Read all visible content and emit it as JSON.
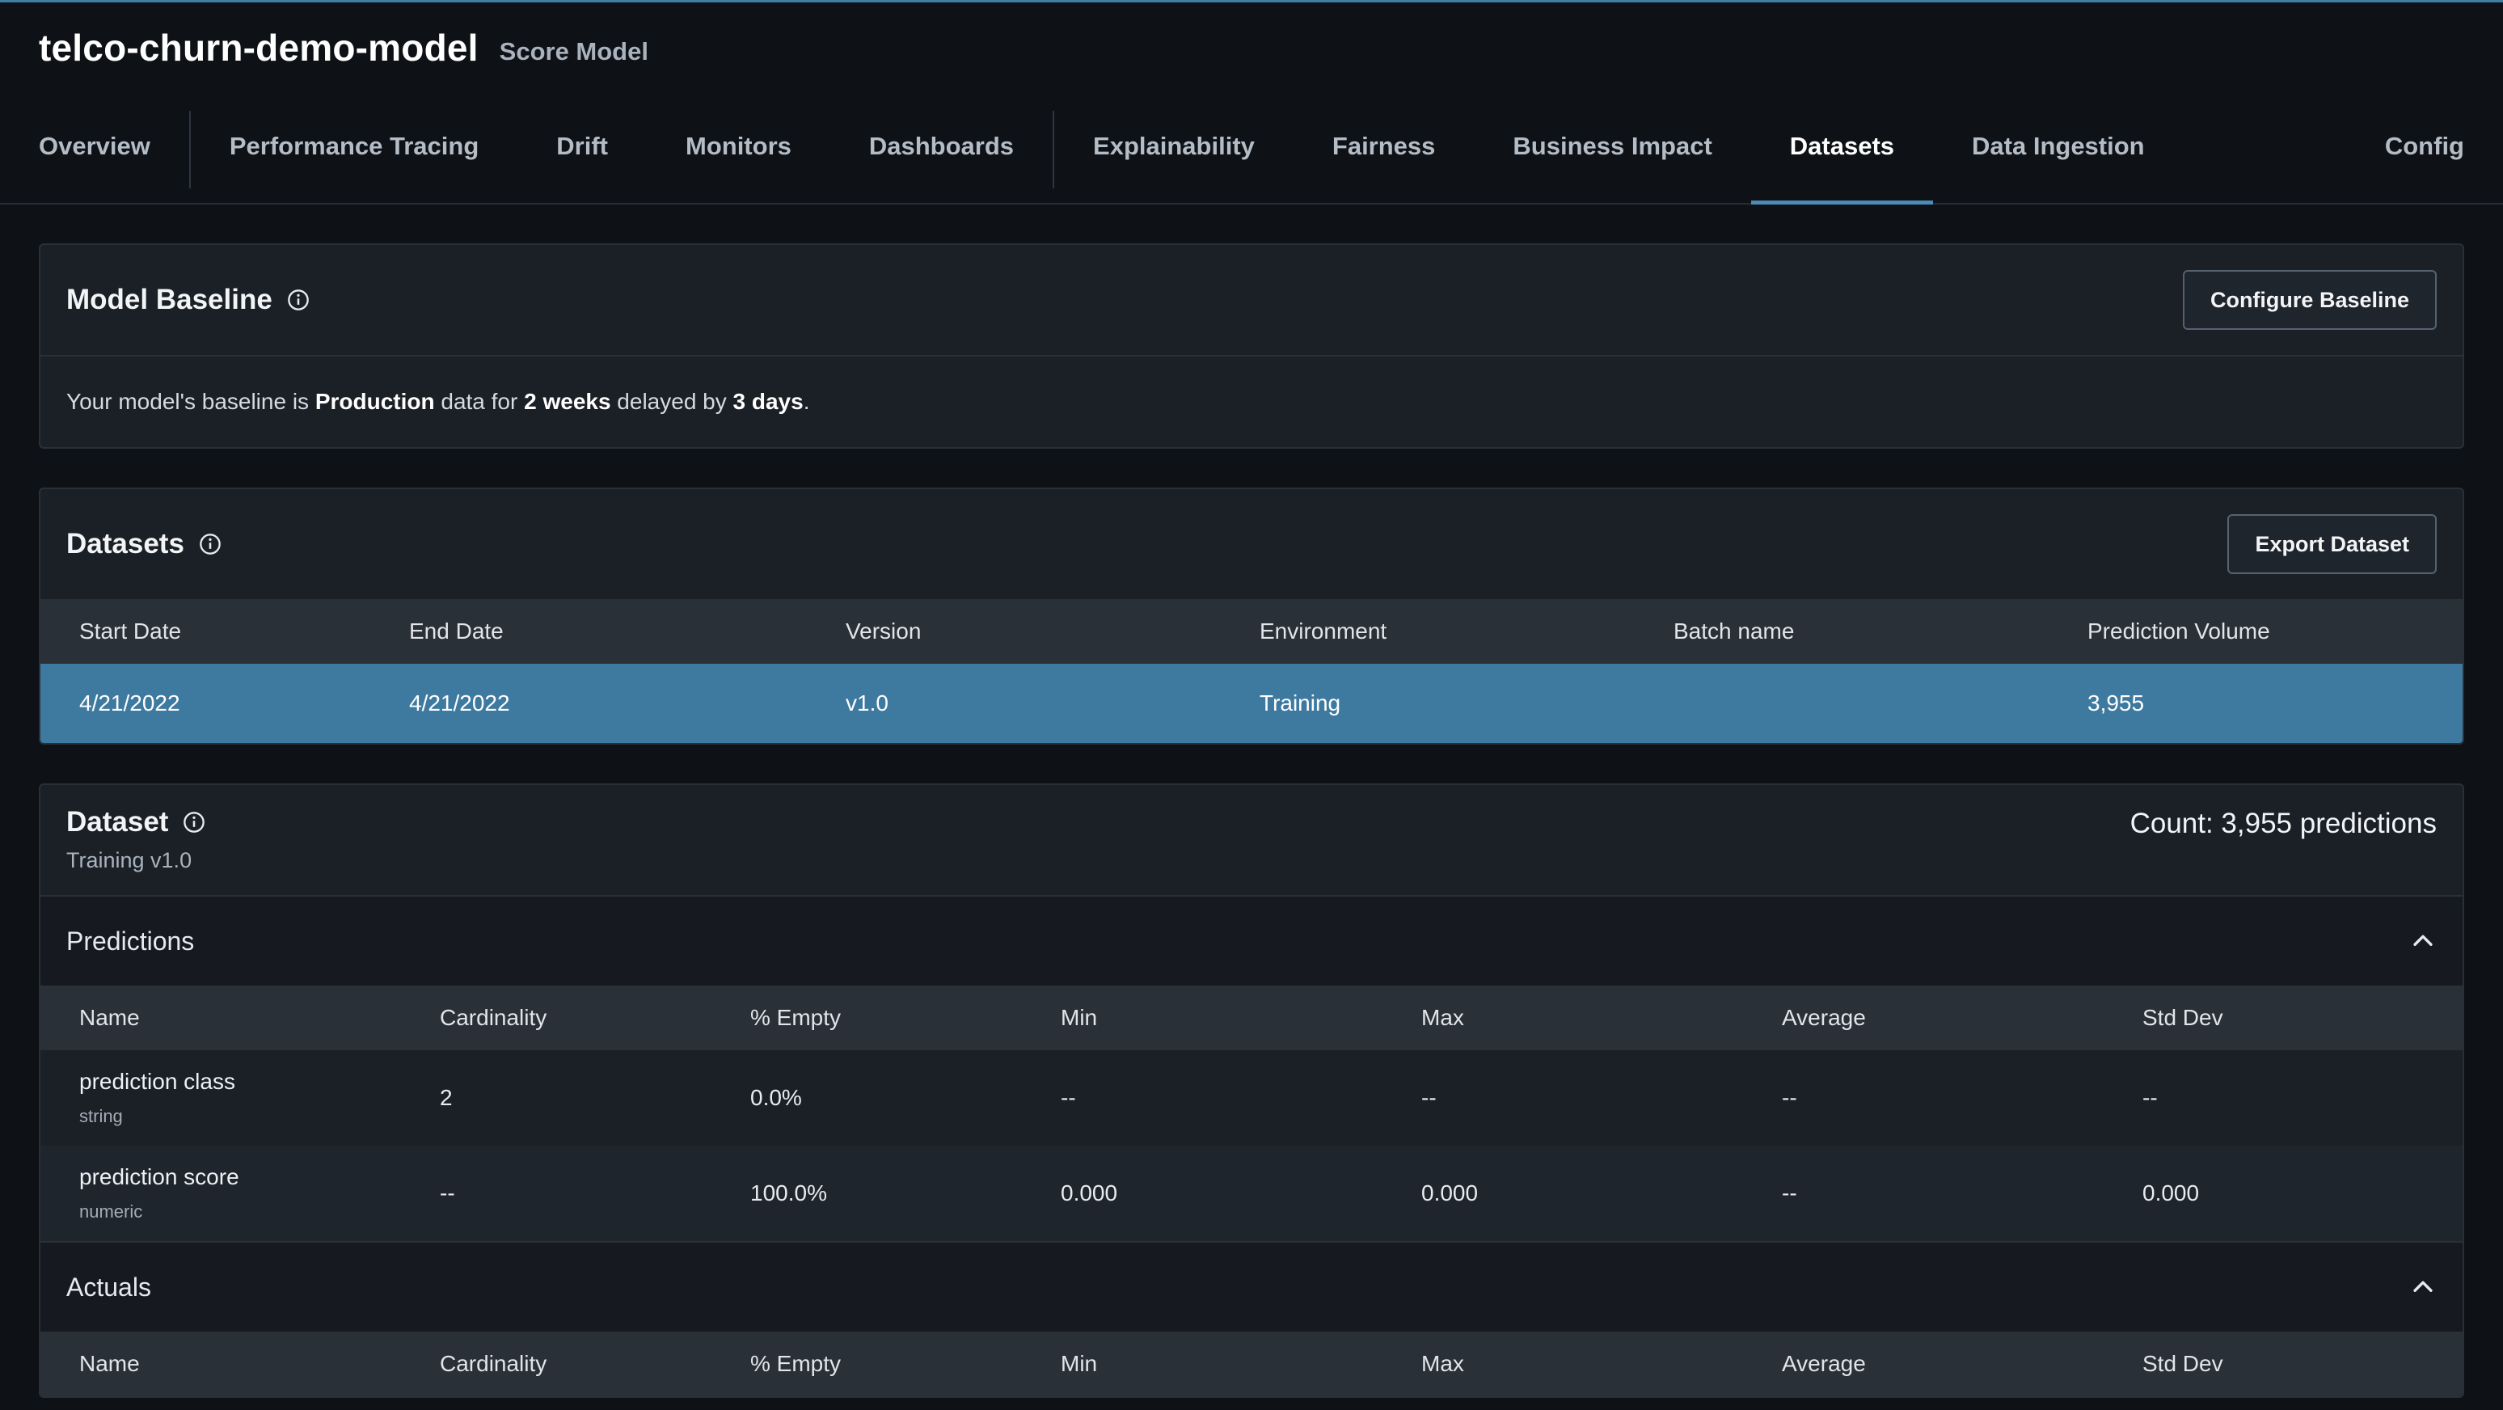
{
  "header": {
    "title": "telco-churn-demo-model",
    "subtitle": "Score Model"
  },
  "tabs": {
    "overview": "Overview",
    "performance_tracing": "Performance Tracing",
    "drift": "Drift",
    "monitors": "Monitors",
    "dashboards": "Dashboards",
    "explainability": "Explainability",
    "fairness": "Fairness",
    "business_impact": "Business Impact",
    "datasets": "Datasets",
    "data_ingestion": "Data Ingestion",
    "config": "Config",
    "active": "Datasets"
  },
  "baseline": {
    "title": "Model Baseline",
    "button": "Configure Baseline",
    "text_1": "Your model's baseline is ",
    "env": "Production",
    "text_2": " data for ",
    "window": "2 weeks",
    "text_3": " delayed by ",
    "delay": "3 days",
    "text_4": "."
  },
  "datasets": {
    "title": "Datasets",
    "button": "Export Dataset",
    "columns": [
      "Start Date",
      "End Date",
      "Version",
      "Environment",
      "Batch name",
      "Prediction Volume"
    ],
    "rows": [
      {
        "start": "4/21/2022",
        "end": "4/21/2022",
        "version": "v1.0",
        "environment": "Training",
        "batch": "",
        "volume": "3,955"
      }
    ]
  },
  "dataset": {
    "title": "Dataset",
    "subtitle": "Training v1.0",
    "count": "Count: 3,955 predictions",
    "predictions": {
      "title": "Predictions",
      "columns": [
        "Name",
        "Cardinality",
        "% Empty",
        "Min",
        "Max",
        "Average",
        "Std Dev"
      ],
      "rows": [
        {
          "name": "prediction class",
          "type": "string",
          "cardinality": "2",
          "empty": "0.0%",
          "min": "--",
          "max": "--",
          "average": "--",
          "std": "--"
        },
        {
          "name": "prediction score",
          "type": "numeric",
          "cardinality": "--",
          "empty": "100.0%",
          "min": "0.000",
          "max": "0.000",
          "average": "--",
          "std": "0.000"
        }
      ]
    },
    "actuals": {
      "title": "Actuals",
      "columns": [
        "Name",
        "Cardinality",
        "% Empty",
        "Min",
        "Max",
        "Average",
        "Std Dev"
      ]
    }
  },
  "colors": {
    "accent": "#4a8cb5",
    "selected_row": "#3e7aa0",
    "background": "#0e1115",
    "card": "#1b2027"
  },
  "icons": {
    "info": "info-circle-icon",
    "collapse": "chevron-up-icon"
  }
}
